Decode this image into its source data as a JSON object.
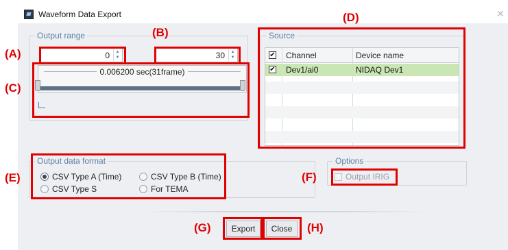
{
  "window": {
    "title": "Waveform Data Export",
    "close_glyph": "✕"
  },
  "output_range": {
    "label": "Output range",
    "start_value": "0",
    "end_value": "30",
    "range_text": "0.006200 sec(31frame)"
  },
  "source": {
    "label": "Source",
    "header_checkbox": "✔",
    "columns": [
      "Channel",
      "Device name"
    ],
    "rows": [
      {
        "checked": "✔",
        "channel": "Dev1/ai0",
        "device": "NIDAQ Dev1"
      }
    ]
  },
  "output_data_format": {
    "label": "Output data format",
    "options": [
      {
        "label": "CSV Type A (Time)",
        "selected": true
      },
      {
        "label": "CSV Type B (Time)",
        "selected": false
      },
      {
        "label": "CSV Type S",
        "selected": false
      },
      {
        "label": "For TEMA",
        "selected": false
      }
    ]
  },
  "options": {
    "label": "Options",
    "output_irig": "Output IRIG"
  },
  "buttons": {
    "export": "Export",
    "close": "Close"
  },
  "annotations": {
    "a": "(A)",
    "b": "(B)",
    "c": "(C)",
    "d": "(D)",
    "e": "(E)",
    "f": "(F)",
    "g": "(G)",
    "h": "(H)"
  },
  "colors": {
    "annotation_red": "#e00000",
    "selected_row_green": "#c9e6b4",
    "group_label_blue": "#5b7fa3",
    "range_fill": "#5d7185"
  }
}
